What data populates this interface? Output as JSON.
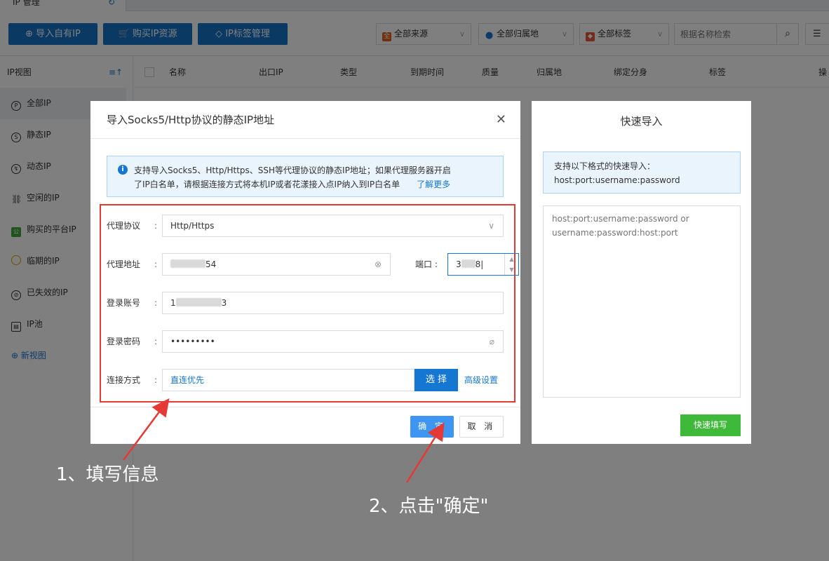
{
  "app": {
    "tab_label": "IP 管理",
    "toolbar": {
      "import_own_ip": "导入自有IP",
      "buy_ip": "购买IP资源",
      "ip_tags": "IP标签管理"
    },
    "filters": {
      "source": "全部来源",
      "location": "全部归属地",
      "tags": "全部标签",
      "search_placeholder": "根据名称检索"
    },
    "sidebar": {
      "title": "IP视图",
      "items": [
        {
          "label": "全部IP",
          "icon": "ip-icon"
        },
        {
          "label": "静态IP",
          "icon": "static-icon"
        },
        {
          "label": "动态IP",
          "icon": "dynamic-icon"
        },
        {
          "label": "空闲的IP",
          "icon": "link-icon"
        },
        {
          "label": "购买的平台IP",
          "icon": "platform-icon"
        },
        {
          "label": "临期的IP",
          "icon": "clock-icon"
        },
        {
          "label": "已失效的IP",
          "icon": "expired-icon"
        },
        {
          "label": "IP池",
          "icon": "pool-icon"
        }
      ],
      "new_view": "新视图"
    },
    "table_columns": [
      "名称",
      "出口IP",
      "类型",
      "到期时间",
      "质量",
      "归属地",
      "绑定分身",
      "标签",
      "操"
    ]
  },
  "dialog": {
    "title": "导入Socks5/Http协议的静态IP地址",
    "notice_line1": "支持导入Socks5、Http/Https、SSH等代理协议的静态IP地址；如果代理服务器开启",
    "notice_line2": "了IP白名单，请根据连接方式将本机IP或者花漾接入点IP纳入到IP白名单",
    "notice_more": "了解更多",
    "fields": {
      "protocol_label": "代理协议",
      "protocol_value": "Http/Https",
      "address_label": "代理地址",
      "address_suffix": "54",
      "port_label": "端口",
      "port_value": "3",
      "port_suffix": "8",
      "account_label": "登录账号",
      "account_prefix": "1",
      "account_suffix": "3",
      "password_label": "登录密码",
      "password_value": "•••••••••",
      "connect_label": "连接方式",
      "connect_value": "直连优先",
      "choose_button": "选 择",
      "advanced_link": "高级设置"
    },
    "ok_button": "确 定",
    "cancel_button": "取 消"
  },
  "quick_import": {
    "title": "快速导入",
    "tip_line1": "支持以下格式的快速导入：",
    "tip_line2": "host:port:username:password",
    "placeholder": "host:port:username:password or\nusername:password:host:port",
    "fill_button": "快速填写"
  },
  "annotations": {
    "step1": "1、填写信息",
    "step2": "2、点击\"确定\""
  },
  "colors": {
    "primary": "#1677d2",
    "highlight_box": "#e53935",
    "quick_fill": "#3fb93a"
  }
}
